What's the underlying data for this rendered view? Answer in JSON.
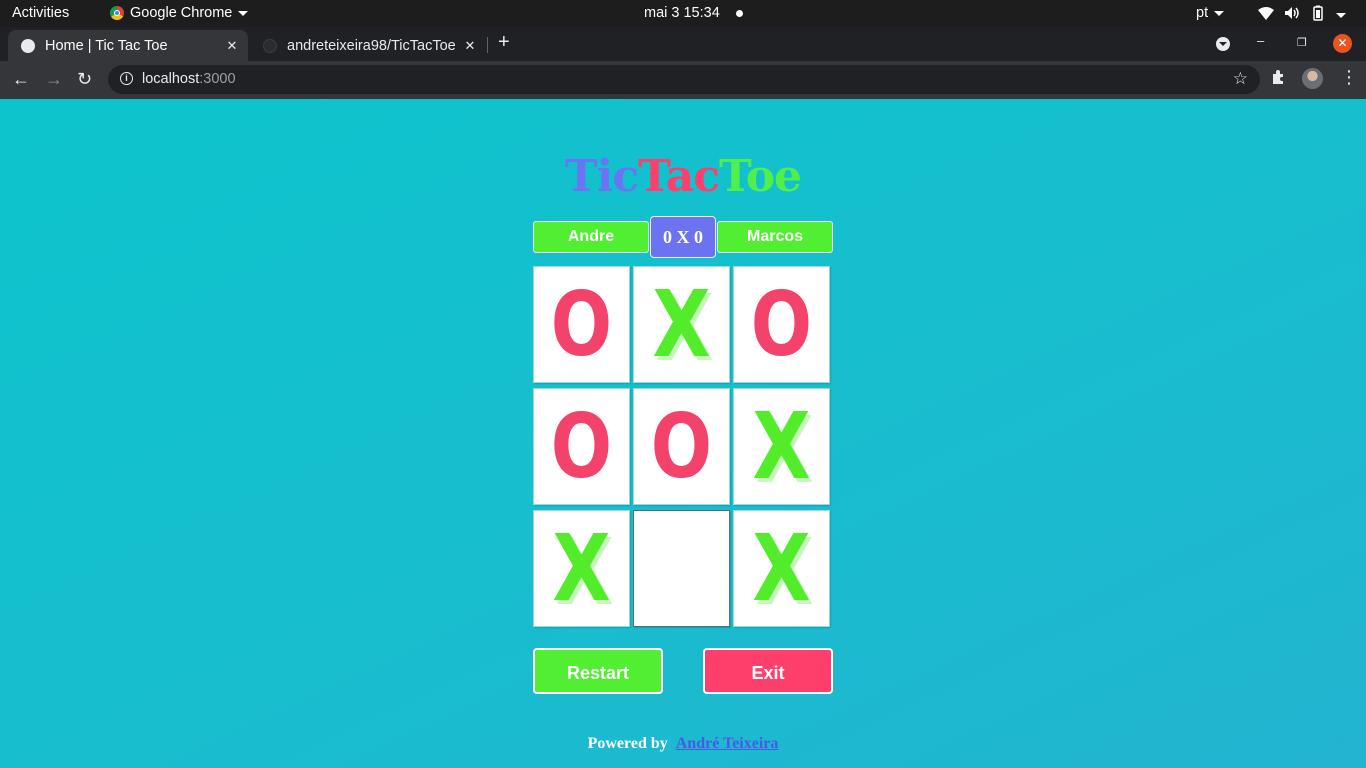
{
  "system_bar": {
    "activities": "Activities",
    "app_name": "Google Chrome",
    "clock": "mai 3  15:34",
    "language": "pt"
  },
  "browser": {
    "tabs": [
      {
        "label": "Home | Tic Tac Toe",
        "active": true
      },
      {
        "label": "andreteixeira98/TicTacToe",
        "active": false
      }
    ],
    "url_host": "localhost",
    "url_port": ":3000"
  },
  "game": {
    "title_parts": [
      "Tic",
      "Tac",
      "Toe"
    ],
    "player1": "Andre",
    "player2": "Marcos",
    "score": "0 X 0",
    "board": [
      [
        "O",
        "X",
        "O"
      ],
      [
        "O",
        "O",
        "X"
      ],
      [
        "X",
        "",
        "X"
      ]
    ],
    "restart_label": "Restart",
    "exit_label": "Exit"
  },
  "footer": {
    "powered_by": "Powered by",
    "author": "André Teixeira"
  },
  "colors": {
    "player_green": "#52ee32",
    "o_red": "#f4436b",
    "score_blue": "#6b73f0",
    "background_teal": "#0dc4cc"
  }
}
